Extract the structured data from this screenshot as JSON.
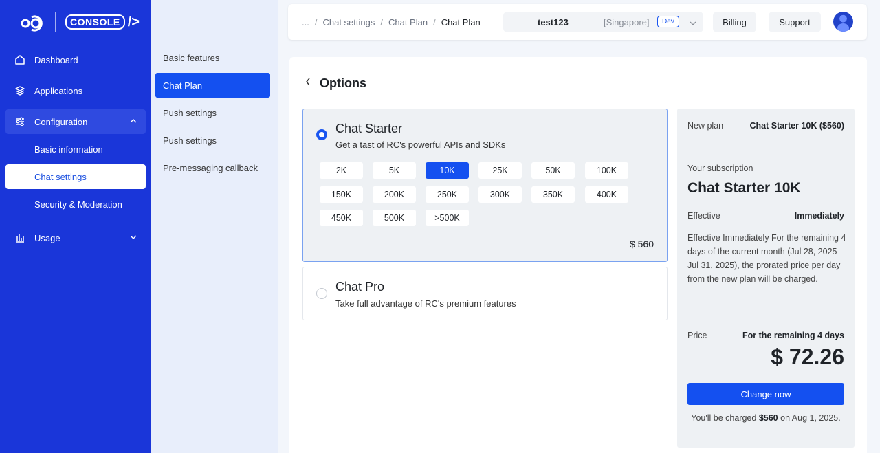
{
  "sidebar": {
    "logo_text": "CONSOLE",
    "logo_glyph": "/>",
    "items": [
      {
        "label": "Dashboard",
        "icon": "home-icon"
      },
      {
        "label": "Applications",
        "icon": "layers-icon"
      },
      {
        "label": "Configuration",
        "icon": "sliders-icon"
      },
      {
        "label": "Usage",
        "icon": "bar-chart-icon"
      }
    ],
    "sub_items": [
      {
        "label": "Basic information"
      },
      {
        "label": "Chat settings"
      },
      {
        "label": "Security & Moderation"
      }
    ]
  },
  "subnav": {
    "items": [
      {
        "label": "Basic features"
      },
      {
        "label": "Chat Plan"
      },
      {
        "label": "Push settings"
      },
      {
        "label": "Push settings"
      },
      {
        "label": "Pre-messaging callback"
      }
    ]
  },
  "header": {
    "breadcrumb": [
      "...",
      "Chat settings",
      "Chat Plan",
      "Chat Plan"
    ],
    "app_name": "test123",
    "app_region": "[Singapore]",
    "env": "Dev",
    "billing_label": "Billing",
    "support_label": "Support"
  },
  "main": {
    "title": "Options",
    "plans": [
      {
        "name": "Chat Starter",
        "desc": "Get a tast of RC's powerful APIs and SDKs",
        "tiers": [
          "2K",
          "5K",
          "10K",
          "25K",
          "50K",
          "100K",
          "150K",
          "200K",
          "250K",
          "300K",
          "350K",
          "400K",
          "450K",
          "500K",
          ">500K"
        ],
        "selected_tier": "10K",
        "price": "$ 560"
      },
      {
        "name": "Chat Pro",
        "desc": "Take full advantage of RC's premium features"
      }
    ]
  },
  "summary": {
    "new_plan_label": "New plan",
    "new_plan_value": "Chat Starter 10K ($560)",
    "subscription_label": "Your subscription",
    "subscription_value": "Chat Starter 10K",
    "effective_label": "Effective",
    "effective_value": "Immediately",
    "note": "Effective Immediately For the remaining 4 days of the current month (Jul 28, 2025-Jul 31, 2025), the prorated price per day from the new plan will be charged.",
    "price_label": "Price",
    "price_period": "For the remaining 4 days",
    "price_value": "$ 72.26",
    "change_button": "Change now",
    "charge_prefix": "You'll be charged",
    "charge_amount": "$560",
    "charge_suffix": "on Aug 1, 2025."
  },
  "colors": {
    "sidebar": "#1a36d9",
    "accent": "#1450f0",
    "subnav": "#e8eefb"
  }
}
